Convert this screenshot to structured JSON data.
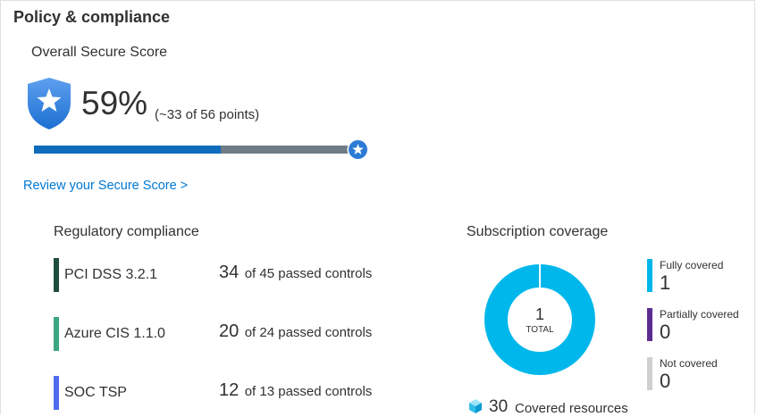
{
  "header": {
    "title": "Policy & compliance"
  },
  "secure_score": {
    "subtitle": "Overall Secure Score",
    "percent_label": "59%",
    "points_label": "(~33 of 56 points)",
    "progress_fraction": 0.59,
    "link_label": "Review your Secure Score >"
  },
  "regulatory": {
    "title": "Regulatory compliance",
    "items": [
      {
        "name": "PCI DSS 3.2.1",
        "passed": "34",
        "rest": "of 45 passed controls",
        "color": "#1e4d3c"
      },
      {
        "name": "Azure CIS 1.1.0",
        "passed": "20",
        "rest": "of 24 passed controls",
        "color": "#3aa683"
      },
      {
        "name": "SOC TSP",
        "passed": "12",
        "rest": "of 13 passed controls",
        "color": "#4f6bed"
      }
    ]
  },
  "coverage": {
    "title": "Subscription coverage",
    "total_value": "1",
    "total_label": "TOTAL",
    "legend": [
      {
        "label": "Fully covered",
        "value": "1",
        "color": "#00b7eb"
      },
      {
        "label": "Partially covered",
        "value": "0",
        "color": "#5c2d91"
      },
      {
        "label": "Not covered",
        "value": "0",
        "color": "#d2d0ce"
      }
    ],
    "covered_resources_count": "30",
    "covered_resources_label": "Covered resources"
  },
  "colors": {
    "accent": "#0078d4",
    "bar_fill": "#0f6cbd",
    "bar_track": "#6f7b85",
    "donut": "#00b7eb"
  }
}
